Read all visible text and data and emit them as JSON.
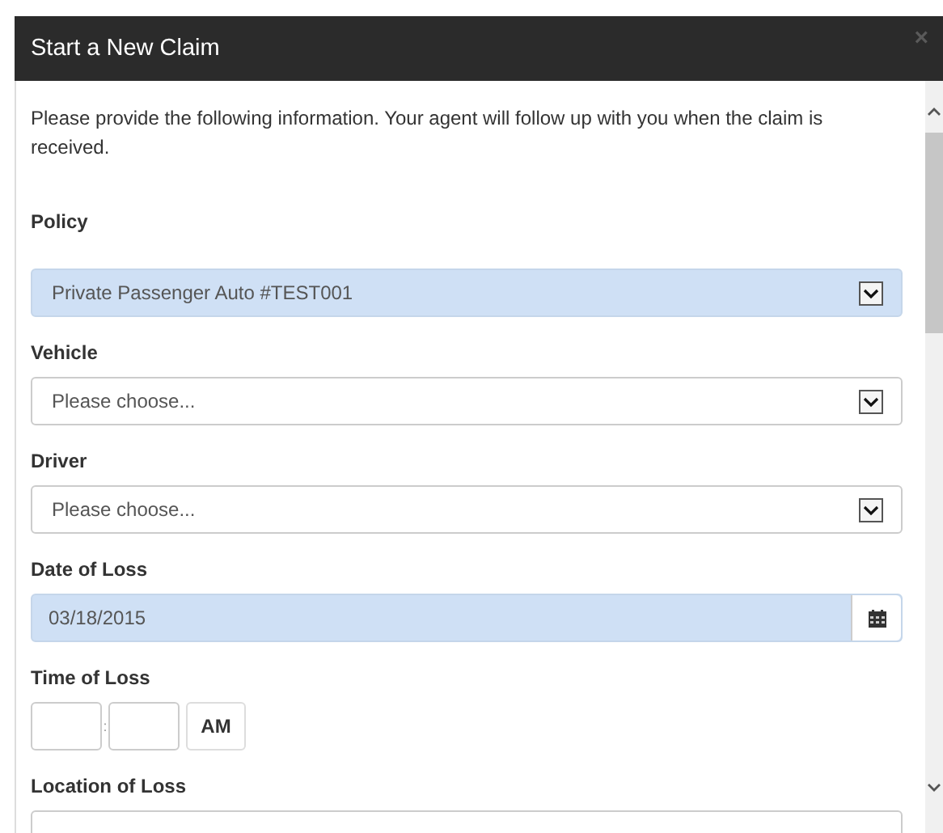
{
  "dialog": {
    "title": "Start a New Claim",
    "close": "×",
    "intro": "Please provide the following information. Your agent will follow up with you when the claim is received.",
    "fields": [
      {
        "kind": "select",
        "label": "Policy",
        "value": "Private Passenger Auto #TEST001",
        "autofilled": true
      },
      {
        "kind": "select",
        "label": "Vehicle",
        "value": "Please choose...",
        "autofilled": false
      },
      {
        "kind": "select",
        "label": "Driver",
        "value": "Please choose...",
        "autofilled": false
      },
      {
        "kind": "date",
        "label": "Date of Loss",
        "value": "03/18/2015",
        "autofilled": true
      },
      {
        "kind": "time",
        "label": "Time of Loss",
        "separator": ":",
        "meridiem": "AM"
      },
      {
        "kind": "text",
        "label": "Location of Loss"
      }
    ]
  }
}
